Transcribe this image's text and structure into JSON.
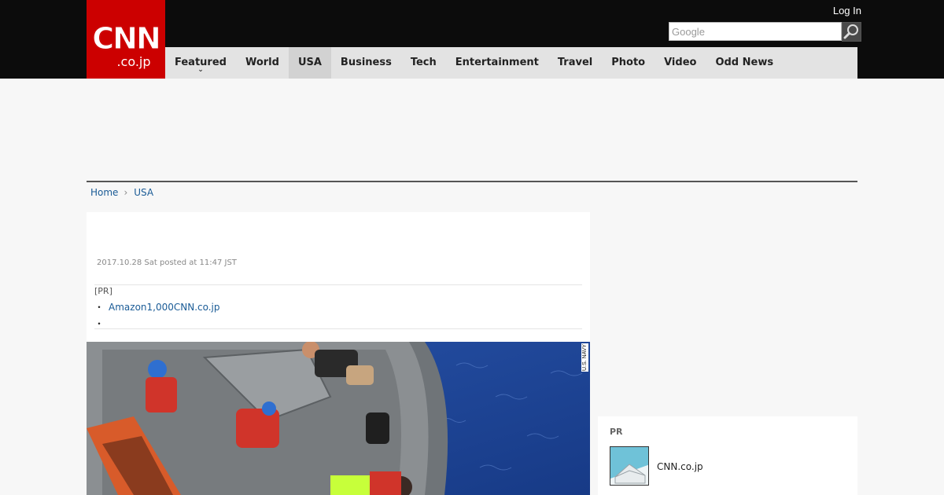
{
  "header": {
    "logo_main": "CNN",
    "logo_sub": ".co.jp",
    "login_label": "Log In",
    "search_placeholder": "Google",
    "search_icon": "search-icon"
  },
  "nav": {
    "items": [
      {
        "label": "Featured"
      },
      {
        "label": "World"
      },
      {
        "label": "USA"
      },
      {
        "label": "Business"
      },
      {
        "label": "Tech"
      },
      {
        "label": "Entertainment"
      },
      {
        "label": "Travel"
      },
      {
        "label": "Photo"
      },
      {
        "label": "Video"
      },
      {
        "label": "Odd News"
      }
    ],
    "active": "USA",
    "featured_caret_icon": "chevron-down-icon"
  },
  "breadcrumb": {
    "home": "Home",
    "current": "USA"
  },
  "article": {
    "timestamp": "2017.10.28 Sat posted at 11:47 JST",
    "pr_label": "[PR]",
    "pr_bullet": "・",
    "pr_link": "Amazon1,000CNN.co.jp",
    "pr_second_bullet": "・",
    "photo_credit": "U.S. NAVY"
  },
  "sidebar": {
    "pr_label": "PR",
    "pr_link": "CNN.co.jp",
    "thumb_icon": "envelope-icon"
  },
  "colors": {
    "brand_red": "#cc0000",
    "topbar": "#0c0c0c",
    "nav_bg": "#e3e3e3",
    "link_blue": "#1a5b96"
  }
}
